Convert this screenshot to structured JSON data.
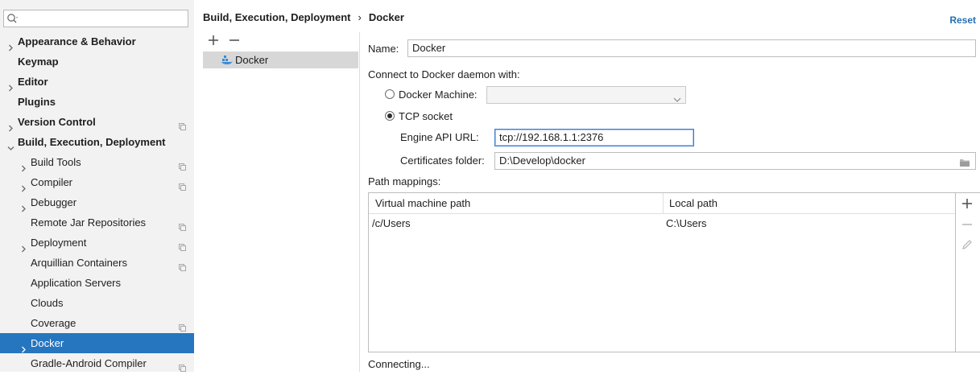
{
  "search": {
    "placeholder": ""
  },
  "sidebar": {
    "items": [
      {
        "label": "Appearance & Behavior",
        "level": 0,
        "arrow": "right"
      },
      {
        "label": "Keymap",
        "level": 0
      },
      {
        "label": "Editor",
        "level": 0,
        "arrow": "right"
      },
      {
        "label": "Plugins",
        "level": 0
      },
      {
        "label": "Version Control",
        "level": 0,
        "arrow": "right",
        "project": true
      },
      {
        "label": "Build, Execution, Deployment",
        "level": 0,
        "arrow": "down"
      },
      {
        "label": "Build Tools",
        "level": 1,
        "arrow": "right",
        "project": true
      },
      {
        "label": "Compiler",
        "level": 1,
        "arrow": "right",
        "project": true
      },
      {
        "label": "Debugger",
        "level": 1,
        "arrow": "right"
      },
      {
        "label": "Remote Jar Repositories",
        "level": 1,
        "project": true
      },
      {
        "label": "Deployment",
        "level": 1,
        "arrow": "right",
        "project": true
      },
      {
        "label": "Arquillian Containers",
        "level": 1,
        "project": true
      },
      {
        "label": "Application Servers",
        "level": 1
      },
      {
        "label": "Clouds",
        "level": 1
      },
      {
        "label": "Coverage",
        "level": 1,
        "project": true
      },
      {
        "label": "Docker",
        "level": 1,
        "arrow": "right",
        "selected": true
      },
      {
        "label": "Gradle-Android Compiler",
        "level": 1,
        "project": true
      }
    ]
  },
  "breadcrumb": {
    "parent": "Build, Execution, Deployment",
    "separator": "›",
    "current": "Docker"
  },
  "header": {
    "reset_label": "Reset"
  },
  "config_list": {
    "items": [
      {
        "label": "Docker",
        "icon": "docker-icon"
      }
    ]
  },
  "form": {
    "name_label": "Name:",
    "name_value": "Docker",
    "connect_label": "Connect to Docker daemon with:",
    "docker_machine_label": "Docker Machine:",
    "docker_machine_value": "",
    "tcp_label": "TCP socket",
    "tcp_selected": true,
    "engine_api_label": "Engine API URL:",
    "engine_api_value": "tcp://192.168.1.1:2376",
    "certs_label": "Certificates folder:",
    "certs_value": "D:\\Develop\\docker",
    "path_mappings_label": "Path mappings:"
  },
  "path_table": {
    "columns": [
      "Virtual machine path",
      "Local path"
    ],
    "rows": [
      [
        "/c/Users",
        "C:\\Users"
      ]
    ]
  },
  "status": {
    "text": "Connecting..."
  },
  "colors": {
    "selection": "#2675bf",
    "link": "#2470b3",
    "sidebar_bg": "#f2f2f2"
  }
}
